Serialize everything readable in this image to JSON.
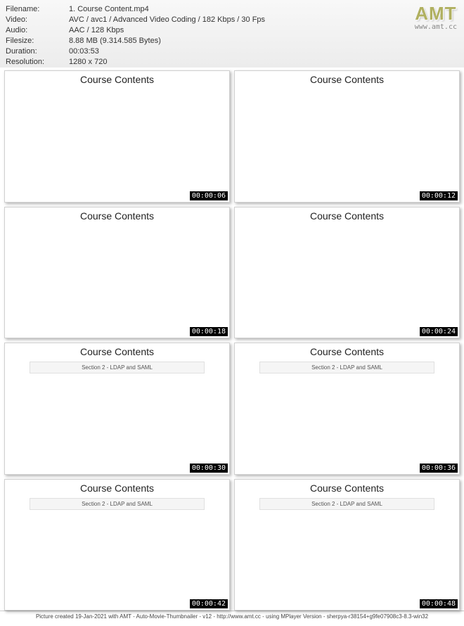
{
  "logo": {
    "main": "AMT",
    "sub": "www.amt.cc"
  },
  "meta": {
    "filename": {
      "label": "Filename:",
      "value": "1. Course Content.mp4"
    },
    "video": {
      "label": "Video:",
      "value": "AVC / avc1 / Advanced Video Coding / 182 Kbps / 30 Fps"
    },
    "audio": {
      "label": "Audio:",
      "value": "AAC / 128 Kbps"
    },
    "filesize": {
      "label": "Filesize:",
      "value": "8.88 MB (9.314.585 Bytes)"
    },
    "duration": {
      "label": "Duration:",
      "value": "00:03:53"
    },
    "resolution": {
      "label": "Resolution:",
      "value": "1280 x 720"
    }
  },
  "thumbs": [
    {
      "title": "Course Contents",
      "section": null,
      "ts": "00:00:06"
    },
    {
      "title": "Course Contents",
      "section": null,
      "ts": "00:00:12"
    },
    {
      "title": "Course Contents",
      "section": null,
      "ts": "00:00:18"
    },
    {
      "title": "Course Contents",
      "section": null,
      "ts": "00:00:24"
    },
    {
      "title": "Course Contents",
      "section": "Section 2 - LDAP and SAML",
      "ts": "00:00:30"
    },
    {
      "title": "Course Contents",
      "section": "Section 2 - LDAP and SAML",
      "ts": "00:00:36"
    },
    {
      "title": "Course Contents",
      "section": "Section 2 - LDAP and SAML",
      "ts": "00:00:42"
    },
    {
      "title": "Course Contents",
      "section": "Section 2 - LDAP and SAML",
      "ts": "00:00:48"
    }
  ],
  "footer": "Picture created 19-Jan-2021 with AMT - Auto-Movie-Thumbnailer - v12 - http://www.amt.cc - using MPlayer Version - sherpya-r38154+g9fe07908c3-8.3-win32"
}
